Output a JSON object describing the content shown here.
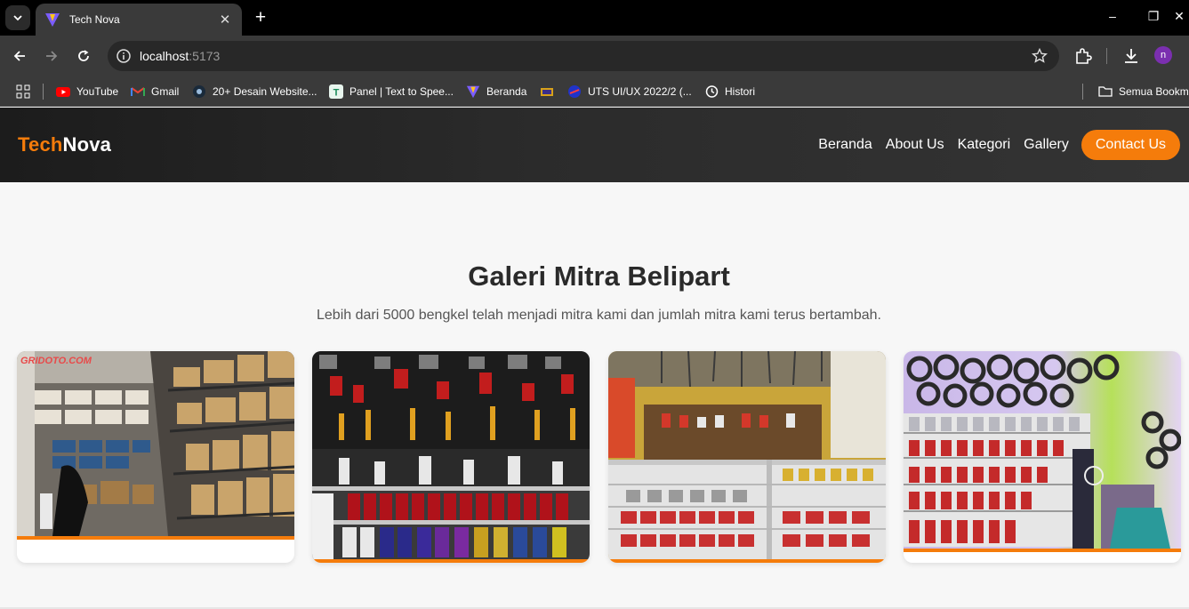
{
  "browser": {
    "tab_title": "Tech Nova",
    "url_host": "localhost",
    "url_port": ":5173",
    "profile_initial": "n",
    "bookmarks": [
      {
        "label": "YouTube"
      },
      {
        "label": "Gmail"
      },
      {
        "label": "20+ Desain Website..."
      },
      {
        "label": "Panel | Text to Spee..."
      },
      {
        "label": "Beranda"
      },
      {
        "label": ""
      },
      {
        "label": "UTS UI/UX 2022/2 (..."
      },
      {
        "label": "Histori"
      },
      {
        "label": "Semua Bookmark"
      }
    ]
  },
  "site": {
    "logo_part1": "Tech",
    "logo_part2": "Nova",
    "nav": [
      "Beranda",
      "About Us",
      "Kategori",
      "Gallery"
    ],
    "contact_label": "Contact Us",
    "colors": {
      "accent": "#f57c0b",
      "header_bg": "#2b2b2b",
      "page_bg": "#f7f7f7"
    }
  },
  "gallery": {
    "title": "Galeri Mitra Belipart",
    "subtitle": "Lebih dari 5000 bengkel telah menjadi mitra kami dan jumlah mitra kami terus bertambah.",
    "photo1_watermark": "GRIDOTO.COM"
  }
}
